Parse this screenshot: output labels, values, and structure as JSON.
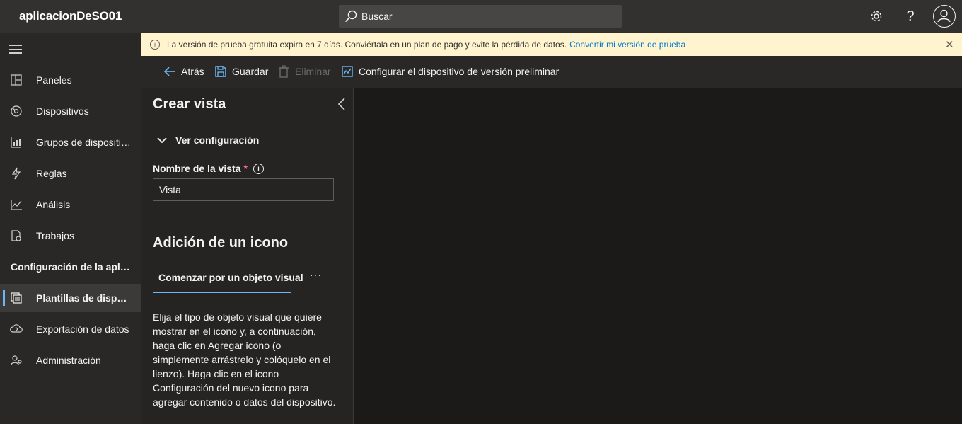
{
  "app": {
    "title": "aplicacionDeSO01"
  },
  "search": {
    "placeholder": "Buscar"
  },
  "topbar": {
    "help_label": "?"
  },
  "sidebar": {
    "items": [
      {
        "label": "Paneles",
        "icon": "dashboard-icon"
      },
      {
        "label": "Dispositivos",
        "icon": "devices-icon"
      },
      {
        "label": "Grupos de dispositivos",
        "icon": "device-groups-icon"
      },
      {
        "label": "Reglas",
        "icon": "rules-icon"
      },
      {
        "label": "Análisis",
        "icon": "analytics-icon"
      },
      {
        "label": "Trabajos",
        "icon": "jobs-icon"
      }
    ],
    "section_label": "Configuración de la aplicación",
    "config_items": [
      {
        "label": "Plantillas de dispositivo",
        "icon": "device-templates-icon",
        "active": true
      },
      {
        "label": "Exportación de datos",
        "icon": "data-export-icon"
      },
      {
        "label": "Administración",
        "icon": "administration-icon"
      }
    ]
  },
  "banner": {
    "message": "La versión de prueba gratuita expira en 7 días. Conviértala en un plan de pago y evite la pérdida de datos.",
    "link": "Convertir mi versión de prueba",
    "info_glyph": "i",
    "close_glyph": "✕"
  },
  "commands": {
    "back": "Atrás",
    "save": "Guardar",
    "delete": "Eliminar",
    "configure_preview": "Configurar el dispositivo de versión preliminar"
  },
  "panel": {
    "title": "Crear vista",
    "accordion_label": "Ver configuración",
    "view_name_label": "Nombre de la vista",
    "required_mark": "*",
    "info_glyph": "i",
    "view_name_value": "Vista",
    "section_title": "Adición de un icono",
    "tab_label": "Comenzar por un objeto visual",
    "more_label": "···",
    "description": "Elija el tipo de objeto visual que quiere mostrar en el icono y, a continuación, haga clic en Agregar icono (o simplemente arrástrelo y colóquelo en el lienzo). Haga clic en el icono Configuración del nuevo icono para agregar contenido o datos del dispositivo."
  },
  "colors": {
    "accent": "#6cb8f6",
    "banner_bg": "#fff4ce",
    "link": "#0078d4",
    "required": "#f1707b"
  }
}
